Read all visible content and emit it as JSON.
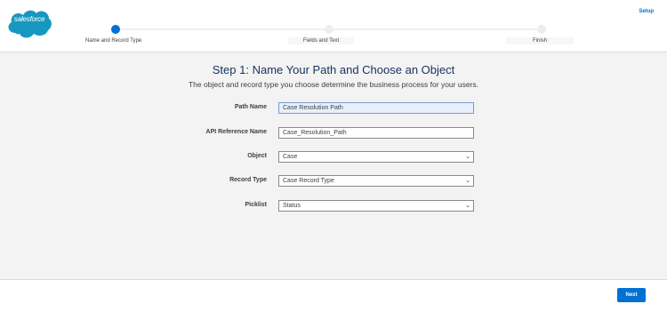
{
  "header": {
    "logo_text": "salesforce",
    "setup_label": "Setup",
    "steps": [
      {
        "label": "Name and Record Type",
        "state": "active"
      },
      {
        "label": "Fields and Text",
        "state": "upcoming"
      },
      {
        "label": "Finish",
        "state": "upcoming"
      }
    ]
  },
  "main": {
    "title": "Step 1: Name Your Path and Choose an Object",
    "subtitle": "The object and record type you choose determine the business process for your users.",
    "fields": [
      {
        "label": "Path Name",
        "value": "Case Resolution Path",
        "kind": "text"
      },
      {
        "label": "API Reference Name",
        "value": "Case_Resolution_Path",
        "kind": "text"
      },
      {
        "label": "Object",
        "value": "Case",
        "kind": "select"
      },
      {
        "label": "Record Type",
        "value": "Case Record Type",
        "kind": "select"
      },
      {
        "label": "Picklist",
        "value": "Status",
        "kind": "select"
      }
    ]
  },
  "footer": {
    "next_label": "Next"
  },
  "colors": {
    "accent": "#0070d2",
    "background": "#f3f3f3",
    "header": "#ffffff"
  }
}
